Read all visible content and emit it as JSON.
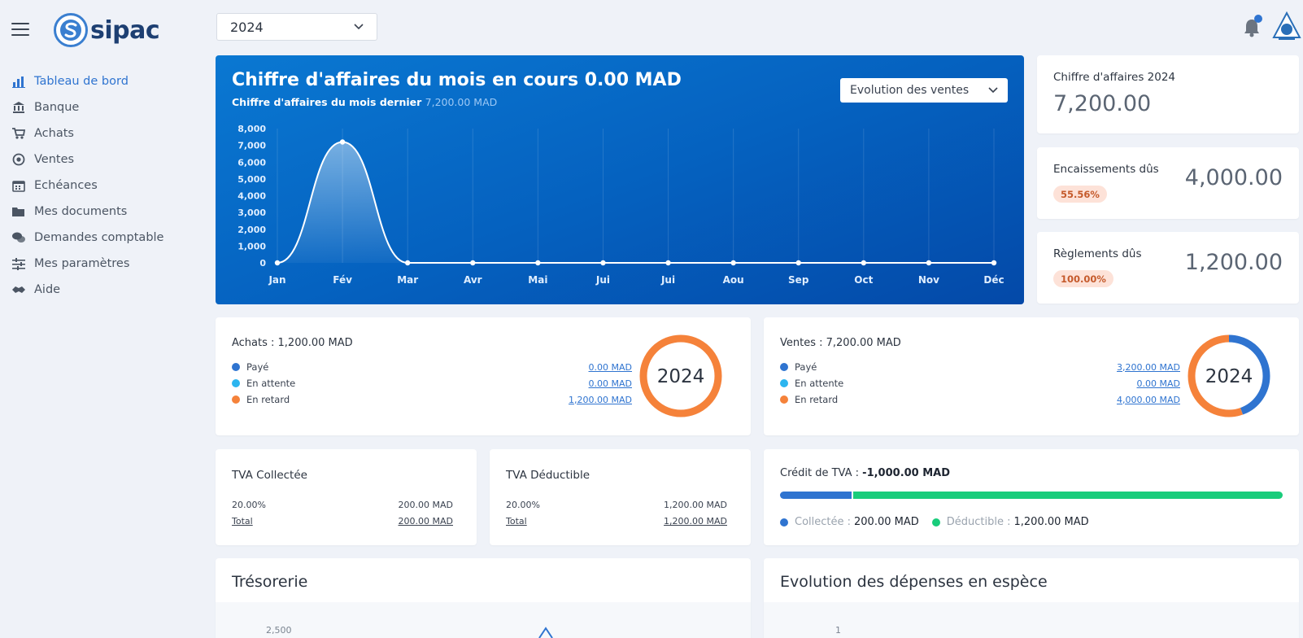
{
  "brand": {
    "name": "sipac"
  },
  "sidebar": {
    "items": [
      {
        "label": "Tableau de bord",
        "icon": "bar-chart-icon",
        "active": true
      },
      {
        "label": "Banque",
        "icon": "bank-icon"
      },
      {
        "label": "Achats",
        "icon": "cart-icon"
      },
      {
        "label": "Ventes",
        "icon": "at-icon"
      },
      {
        "label": "Echéances",
        "icon": "calendar-icon"
      },
      {
        "label": "Mes documents",
        "icon": "folder-icon"
      },
      {
        "label": "Demandes comptable",
        "icon": "comments-icon"
      },
      {
        "label": "Mes paramètres",
        "icon": "sliders-icon"
      },
      {
        "label": "Aide",
        "icon": "handshake-icon"
      }
    ]
  },
  "topbar": {
    "year": "2024",
    "notification_indicator": true
  },
  "sales_card": {
    "title": "Chiffre d'affaires du mois en cours 0.00 MAD",
    "subtitle_label": "Chiffre d'affaires du mois dernier",
    "subtitle_value": "7,200.00 MAD",
    "mode_select": "Evolution des ventes"
  },
  "chart_data": {
    "type": "area",
    "categories": [
      "Jan",
      "Fév",
      "Mar",
      "Avr",
      "Mai",
      "Jui",
      "Jui",
      "Aou",
      "Sep",
      "Oct",
      "Nov",
      "Déc"
    ],
    "values": [
      0,
      7200,
      0,
      0,
      0,
      0,
      0,
      0,
      0,
      0,
      0,
      0
    ],
    "ylim": [
      0,
      8000
    ],
    "yticks": [
      "0",
      "1,000",
      "2,000",
      "3,000",
      "4,000",
      "5,000",
      "6,000",
      "7,000",
      "8,000"
    ],
    "grid": "vertical"
  },
  "stats": {
    "ca": {
      "label": "Chiffre d'affaires 2024",
      "value": "7,200.00"
    },
    "encaissements": {
      "label": "Encaissements dûs",
      "badge": "55.56%",
      "value": "4,000.00"
    },
    "reglements": {
      "label": "Règlements dûs",
      "badge": "100.00%",
      "value": "1,200.00"
    }
  },
  "achats": {
    "title": "Achats : 1,200.00 MAD",
    "rows": [
      {
        "label": "Payé",
        "value": "0.00 MAD",
        "color": "#2f74d0"
      },
      {
        "label": "En attente",
        "value": "0.00 MAD",
        "color": "#2cb5ef"
      },
      {
        "label": "En retard",
        "value": "1,200.00 MAD",
        "color": "#f5823a"
      }
    ],
    "donut_label": "2024",
    "donut_fractions": [
      0,
      0,
      1
    ]
  },
  "ventes": {
    "title": "Ventes : 7,200.00 MAD",
    "rows": [
      {
        "label": "Payé",
        "value": "3,200.00 MAD",
        "color": "#2f74d0"
      },
      {
        "label": "En attente",
        "value": "0.00 MAD",
        "color": "#2cb5ef"
      },
      {
        "label": "En retard",
        "value": "4,000.00 MAD",
        "color": "#f5823a"
      }
    ],
    "donut_label": "2024",
    "donut_fractions": [
      0.4444,
      0,
      0.5556
    ]
  },
  "tva_collectee": {
    "title": "TVA Collectée",
    "rate": "20.00%",
    "rate_value": "200.00 MAD",
    "total_label": "Total",
    "total_value": "200.00 MAD"
  },
  "tva_deductible": {
    "title": "TVA Déductible",
    "rate": "20.00%",
    "rate_value": "1,200.00 MAD",
    "total_label": "Total",
    "total_value": "1,200.00 MAD"
  },
  "credit_tva": {
    "label": "Crédit de TVA :",
    "value": "-1,000.00 MAD",
    "collectee_label": "Collectée :",
    "collectee_value": "200.00 MAD",
    "deductible_label": "Déductible :",
    "deductible_value": "1,200.00 MAD",
    "collectee_fraction": 0.1429,
    "colors": {
      "collectee": "#2f74d0",
      "deductible": "#19cc7b"
    }
  },
  "tresorerie": {
    "title": "Trésorerie",
    "first_tick": "2,500"
  },
  "depenses": {
    "title": "Evolution des dépenses en espèce",
    "first_tick": "1"
  }
}
